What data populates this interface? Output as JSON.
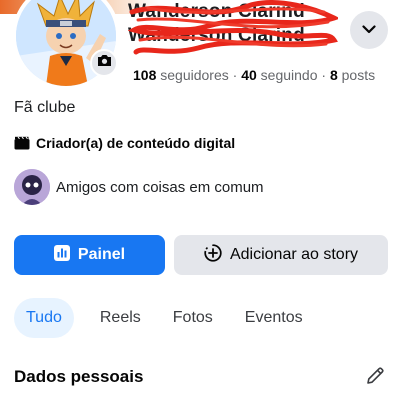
{
  "profile": {
    "name_line1": "Wanderson Clarind",
    "name_line2": "Wanderson Clarind",
    "stats": {
      "followers_count": "108",
      "followers_label": "seguidores",
      "following_count": "40",
      "following_label": "seguindo",
      "posts_count": "8",
      "posts_label": "posts",
      "separator": "·"
    },
    "bio": "Fã clube",
    "category": "Criador(a) de conteúdo digital",
    "mutual_friends_text": "Amigos com coisas em comum"
  },
  "actions": {
    "primary_label": "Painel",
    "secondary_label": "Adicionar ao story"
  },
  "tabs": [
    "Tudo",
    "Reels",
    "Fotos",
    "Eventos"
  ],
  "section": {
    "title": "Dados pessoais"
  },
  "icons": {
    "camera": "camera-icon",
    "chevron": "chevron-down-icon",
    "category": "clapperboard-icon",
    "dashboard": "bar-chart-icon",
    "add_story": "plus-circle-icon",
    "edit": "pencil-icon"
  },
  "colors": {
    "accent": "#1877f2",
    "button_gray": "#e4e6eb",
    "secondary_text": "#65676b",
    "active_tab_bg": "#e7f3ff",
    "scribble": "#e8271b"
  }
}
